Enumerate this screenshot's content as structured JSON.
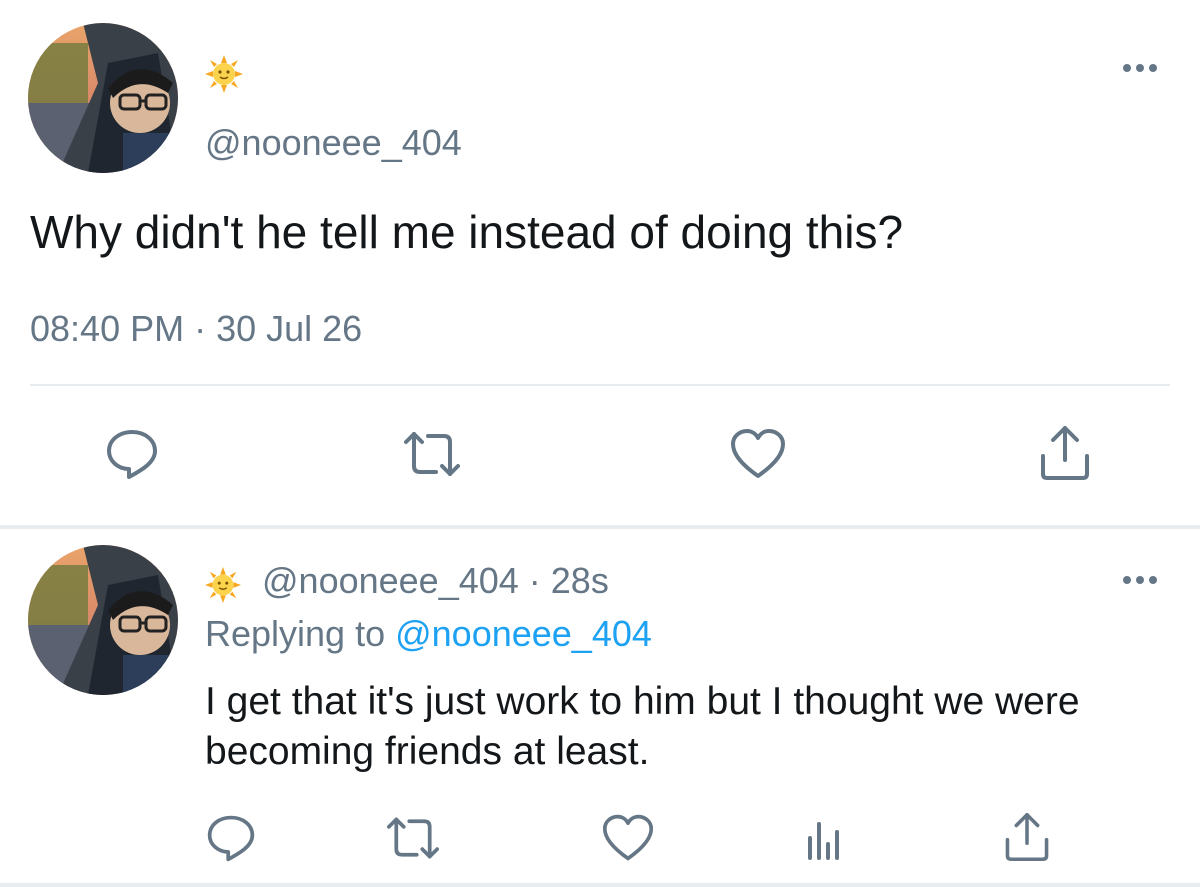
{
  "main_tweet": {
    "avatar_icon": "profile-photo",
    "display_emoji": "sun-with-face-icon",
    "handle": "@nooneee_404",
    "text": "Why didn't he tell me instead of doing this?",
    "timestamp": "08:40 PM · 30 Jul 26",
    "more_icon": "more-horizontal-icon",
    "actions": [
      "reply-icon",
      "retweet-icon",
      "like-icon",
      "share-icon"
    ]
  },
  "reply_tweet": {
    "avatar_icon": "profile-photo",
    "display_emoji": "sun-with-face-icon",
    "header": "@nooneee_404 · 28s",
    "replying_prefix": "Replying to ",
    "replying_mention": "@nooneee_404",
    "text": "I get that it's just work to him but I thought we were becoming friends at least.",
    "more_icon": "more-horizontal-icon",
    "actions": [
      "reply-icon",
      "retweet-icon",
      "like-icon",
      "analytics-icon",
      "share-icon"
    ]
  },
  "colors": {
    "text_primary": "#14171a",
    "text_secondary": "#657786",
    "link": "#1da1f2",
    "icon": "#657786",
    "divider": "#e6ecf0"
  }
}
